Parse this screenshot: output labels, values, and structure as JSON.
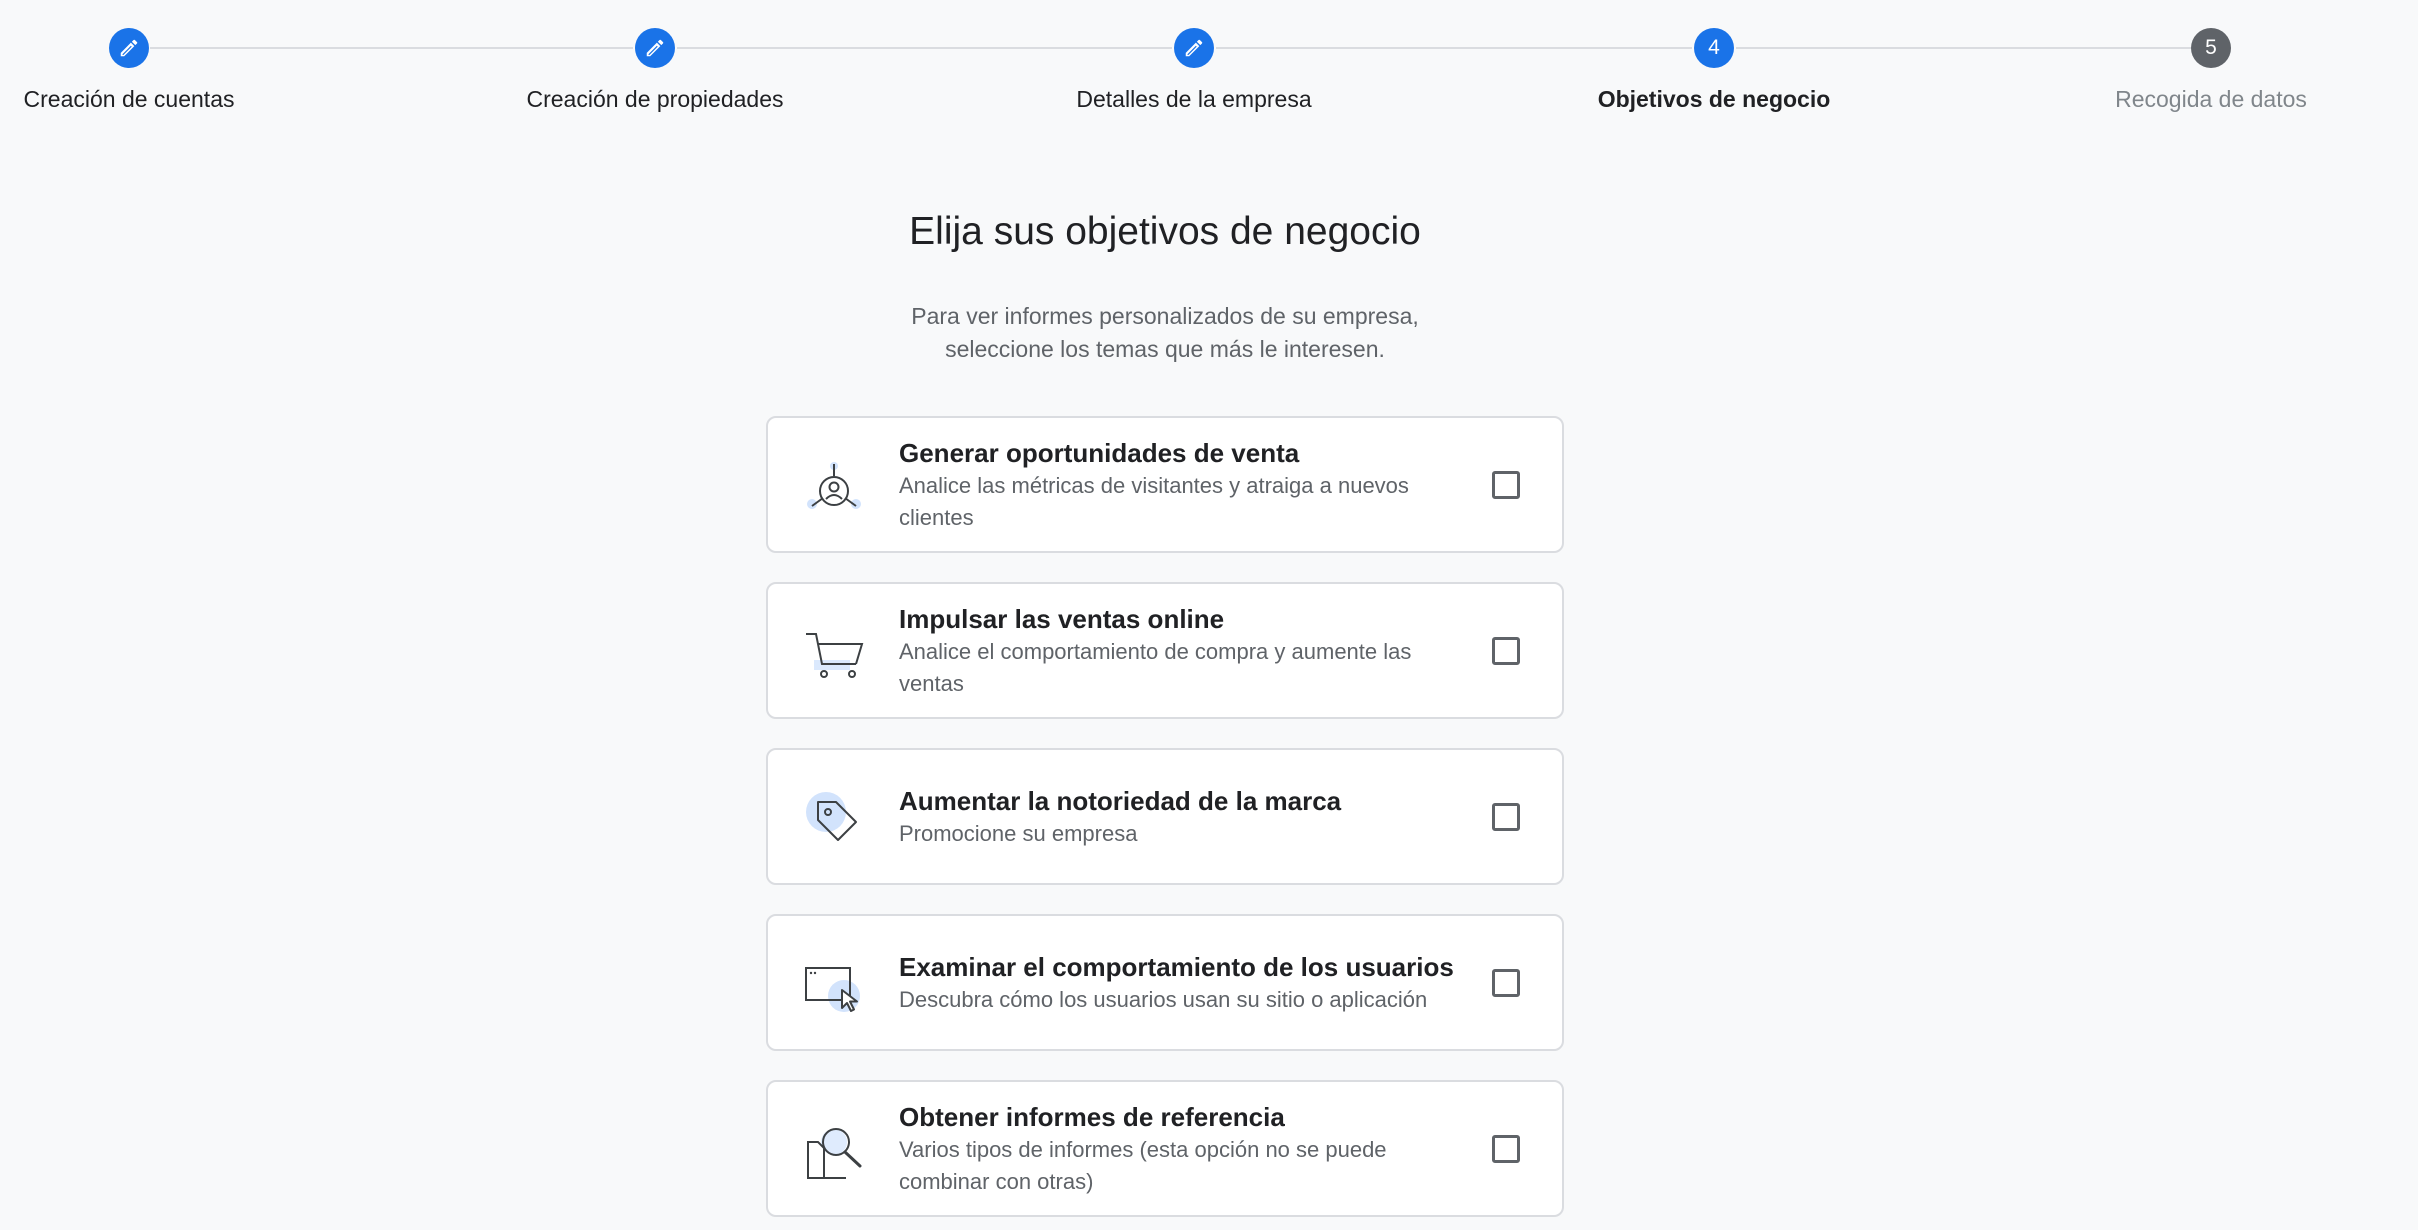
{
  "stepper": {
    "steps": [
      {
        "label": "Creación de cuentas",
        "state": "completed",
        "icon": "pencil-icon"
      },
      {
        "label": "Creación de propiedades",
        "state": "completed",
        "icon": "pencil-icon"
      },
      {
        "label": "Detalles de la empresa",
        "state": "completed",
        "icon": "pencil-icon"
      },
      {
        "label": "Objetivos de negocio",
        "state": "current",
        "number": "4"
      },
      {
        "label": "Recogida de datos",
        "state": "pending",
        "number": "5"
      }
    ]
  },
  "page": {
    "title": "Elija sus objetivos de negocio",
    "subtitle": "Para ver informes personalizados de su empresa, seleccione los temas que más le interesen."
  },
  "goals": [
    {
      "title": "Generar oportunidades de venta",
      "description": "Analice las métricas de visitantes y atraiga a nuevos clientes",
      "icon": "lead-generation-icon",
      "checked": false
    },
    {
      "title": "Impulsar las ventas online",
      "description": "Analice el comportamiento de compra y aumente las ventas",
      "icon": "shopping-cart-icon",
      "checked": false
    },
    {
      "title": "Aumentar la notoriedad de la marca",
      "description": "Promocione su empresa",
      "icon": "tag-icon",
      "checked": false
    },
    {
      "title": "Examinar el comportamiento de los usuarios",
      "description": "Descubra cómo los usuarios usan su sitio o aplicación",
      "icon": "browser-cursor-icon",
      "checked": false
    },
    {
      "title": "Obtener informes de referencia",
      "description": "Varios tipos de informes (esta opción no se puede combinar con otras)",
      "icon": "document-magnifier-icon",
      "checked": false
    }
  ],
  "colors": {
    "accent": "#1a73e8",
    "pending": "#5f6368",
    "icon_highlight": "#d2e3fc",
    "background": "#f8f9fa"
  }
}
